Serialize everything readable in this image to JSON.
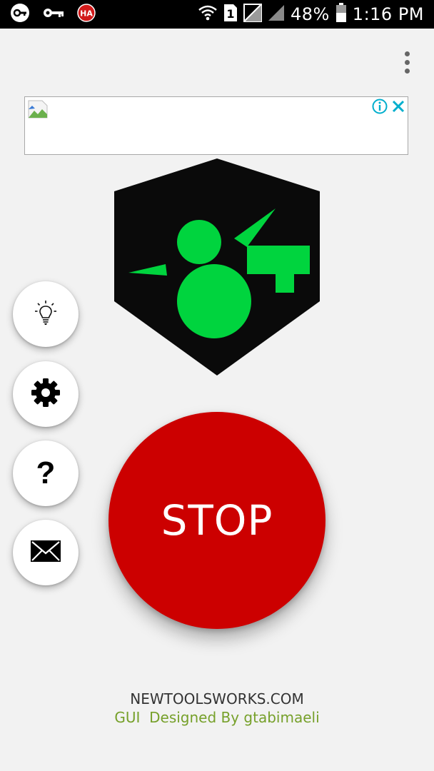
{
  "status_bar": {
    "left_icons": [
      "vpn-key-icon",
      "key-icon",
      "app-badge-icon"
    ],
    "app_badge_text": "HA",
    "right_icons": [
      "wifi-icon",
      "sim-1-icon",
      "no-signal-icon",
      "signal-icon",
      "battery-icon"
    ],
    "sim_label": "1",
    "battery_percent": "48%",
    "time": "1:16 PM"
  },
  "ad": {
    "icons": [
      "broken-image-icon",
      "ad-info-icon",
      "ad-close-icon"
    ]
  },
  "logo": {
    "icon": "key-logo-icon",
    "colors": {
      "background": "#0a0a0a",
      "key": "#00d43e"
    }
  },
  "side_buttons": [
    {
      "name": "tips",
      "icon": "lightbulb-icon"
    },
    {
      "name": "settings",
      "icon": "gear-icon"
    },
    {
      "name": "help",
      "icon": "question-icon",
      "glyph": "?"
    },
    {
      "name": "contact",
      "icon": "envelope-icon"
    }
  ],
  "stop_button": {
    "label": "STOP",
    "color": "#cc0000"
  },
  "footer": {
    "site": "NEWTOOLSWORKS.COM",
    "credit": "GUI  Designed By gtabimaeli",
    "credit_color": "#76a02a"
  }
}
